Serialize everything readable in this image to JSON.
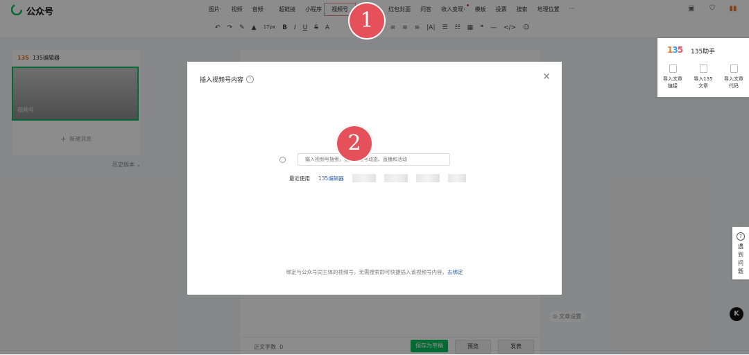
{
  "app": {
    "title": "公众号"
  },
  "menu": [
    {
      "label": "图片·"
    },
    {
      "label": "视频"
    },
    {
      "label": "音频·"
    },
    {
      "label": "超链接"
    },
    {
      "label": "小程序"
    },
    {
      "label": "视频号"
    },
    {
      "label": "红包封面"
    },
    {
      "label": "问答"
    },
    {
      "label": "收入变现·"
    },
    {
      "label": "模板"
    },
    {
      "label": "投票"
    },
    {
      "label": "搜索"
    },
    {
      "label": "地理位置"
    },
    {
      "label": "···"
    }
  ],
  "toolbar": {
    "font_size": "17px"
  },
  "left_panel": {
    "brand": "135编辑器",
    "thumb_label": "视频号",
    "new_message": "新建消息",
    "history": "历史版本"
  },
  "modal": {
    "title": "插入视频号内容",
    "search_placeholder": "输入视频号搜索，或查找账号动态、直播和活动",
    "recent_label": "最近使用",
    "recent_item": "135编辑器",
    "footer_text": "绑定与公众号同主体的视频号，无需搜索即可快捷插入该视频号内容。",
    "bind_link": "去绑定"
  },
  "helper": {
    "title": "135助手",
    "items": [
      {
        "line1": "导入文章",
        "line2": "链接"
      },
      {
        "line1": "导入135",
        "line2": "文章"
      },
      {
        "line1": "导入文章",
        "line2": "代码"
      }
    ]
  },
  "help_tab": {
    "text": "遇到问题"
  },
  "article_settings": "文章设置",
  "bottom": {
    "wordcount_label": "正文字数",
    "wordcount_value": "0",
    "save": "保存为草稿",
    "preview": "预览",
    "publish": "发表"
  },
  "steps": [
    "1",
    "2"
  ],
  "colors": {
    "accent_green": "#07c160",
    "step_red": "#e5505a",
    "link_blue": "#2d5fa6"
  }
}
